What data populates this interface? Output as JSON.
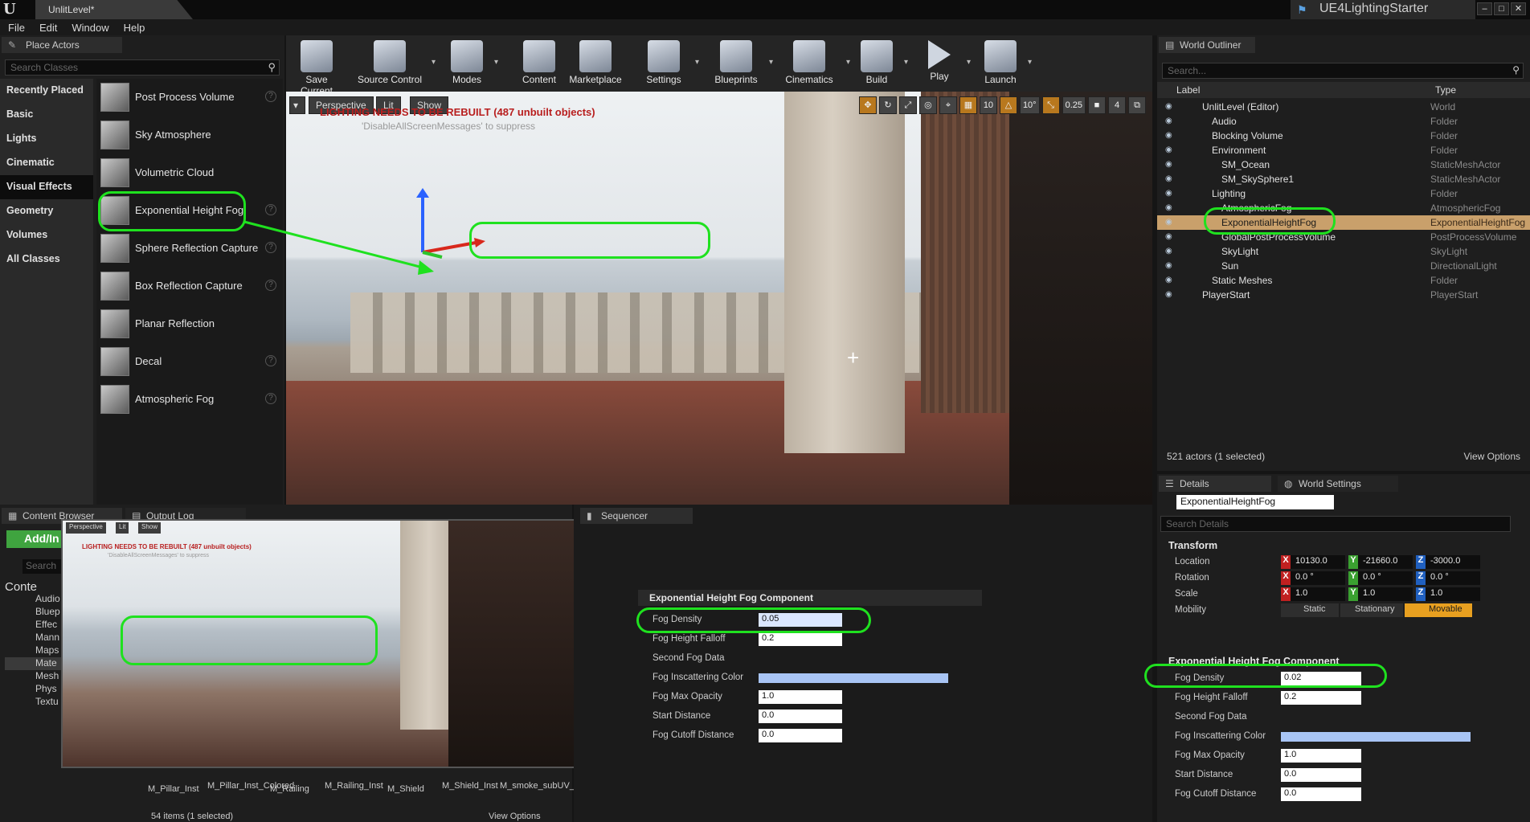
{
  "window": {
    "level_tab": "UnlitLevel*",
    "project": "UE4LightingStarter",
    "controls": [
      "–",
      "□",
      "✕"
    ]
  },
  "menu": [
    "File",
    "Edit",
    "Window",
    "Help"
  ],
  "place_actors": {
    "tab": "Place Actors",
    "search_placeholder": "Search Classes",
    "categories": [
      "Recently Placed",
      "Basic",
      "Lights",
      "Cinematic",
      "Visual Effects",
      "Geometry",
      "Volumes",
      "All Classes"
    ],
    "selected_category": "Visual Effects",
    "actors": [
      "Post Process Volume",
      "Sky Atmosphere",
      "Volumetric Cloud",
      "Exponential Height Fog",
      "Sphere Reflection Capture",
      "Box Reflection Capture",
      "Planar Reflection",
      "Decal",
      "Atmospheric Fog"
    ]
  },
  "toolbar": [
    "Save Current",
    "Source Control",
    "Modes",
    "Content",
    "Marketplace",
    "Settings",
    "Blueprints",
    "Cinematics",
    "Build",
    "Play",
    "Launch"
  ],
  "viewport": {
    "perspective": "Perspective",
    "lit": "Lit",
    "show": "Show",
    "warning": "LIGHTING NEEDS TO BE REBUILT (487 unbuilt objects)",
    "suppress": "'DisableAllScreenMessages' to suppress",
    "grid_snap": "10",
    "rot_snap": "10°",
    "scale_snap": "0.25",
    "cam_speed": "4"
  },
  "outliner": {
    "tab": "World Outliner",
    "search_placeholder": "Search...",
    "col_label": "Label",
    "col_type": "Type",
    "rows": [
      {
        "label": "UnlitLevel (Editor)",
        "type": "World"
      },
      {
        "label": "Audio",
        "type": "Folder"
      },
      {
        "label": "Blocking Volume",
        "type": "Folder"
      },
      {
        "label": "Environment",
        "type": "Folder"
      },
      {
        "label": "SM_Ocean",
        "type": "StaticMeshActor"
      },
      {
        "label": "SM_SkySphere1",
        "type": "StaticMeshActor"
      },
      {
        "label": "Lighting",
        "type": "Folder"
      },
      {
        "label": "AtmosphericFog",
        "type": "AtmosphericFog"
      },
      {
        "label": "ExponentialHeightFog",
        "type": "ExponentialHeightFog"
      },
      {
        "label": "GlobalPostProcessVolume",
        "type": "PostProcessVolume"
      },
      {
        "label": "SkyLight",
        "type": "SkyLight"
      },
      {
        "label": "Sun",
        "type": "DirectionalLight"
      },
      {
        "label": "Static Meshes",
        "type": "Folder"
      },
      {
        "label": "PlayerStart",
        "type": "PlayerStart"
      }
    ],
    "count": "521 actors (1 selected)",
    "view_options": "View Options"
  },
  "details": {
    "tab": "Details",
    "tab2": "World Settings",
    "name": "ExponentialHeightFog",
    "search_placeholder": "Search Details",
    "transform": "Transform",
    "location_label": "Location",
    "rotation_label": "Rotation",
    "scale_label": "Scale",
    "mobility_label": "Mobility",
    "location": [
      "10130.0",
      "-21660.0",
      "-3000.0"
    ],
    "rotation": [
      "0.0 °",
      "0.0 °",
      "0.0 °"
    ],
    "scale": [
      "1.0",
      "1.0",
      "1.0"
    ],
    "mobility": [
      "Static",
      "Stationary",
      "Movable"
    ],
    "component": "Exponential Height Fog Component",
    "props": [
      {
        "label": "Fog Density",
        "value": "0.02"
      },
      {
        "label": "Fog Height Falloff",
        "value": "0.2"
      },
      {
        "label": "Second Fog Data",
        "value": ""
      },
      {
        "label": "Fog Inscattering Color",
        "value": ""
      },
      {
        "label": "Fog Max Opacity",
        "value": "1.0"
      },
      {
        "label": "Start Distance",
        "value": "0.0"
      },
      {
        "label": "Fog Cutoff Distance",
        "value": "0.0"
      }
    ]
  },
  "bottom": {
    "content_tab": "Content Browser",
    "output_tab": "Output Log",
    "add_new": "Add/In",
    "search": "Search",
    "tree": [
      "Conte",
      "Audio",
      "Bluep",
      "Effec",
      "Mann",
      "Maps",
      "Mate",
      "Mesh",
      "Phys",
      "Textu"
    ],
    "assets": [
      "M_Pillar_Inst",
      "M_Pillar_Inst_Colored",
      "M_Railing",
      "M_Railing_Inst",
      "M_Shield",
      "M_Shield_Inst",
      "M_smoke_subUV_"
    ],
    "items": "54 items (1 selected)",
    "view_options": "View Options",
    "sequencer_tab": "Sequencer",
    "seq_component": "Exponential Height Fog Component",
    "seq_props": [
      {
        "label": "Fog Density",
        "value": "0.05"
      },
      {
        "label": "Fog Height Falloff",
        "value": "0.2"
      },
      {
        "label": "Second Fog Data",
        "value": ""
      },
      {
        "label": "Fog Inscattering Color",
        "value": ""
      },
      {
        "label": "Fog Max Opacity",
        "value": "1.0"
      },
      {
        "label": "Start Distance",
        "value": "0.0"
      },
      {
        "label": "Fog Cutoff Distance",
        "value": "0.0"
      }
    ],
    "mini_warning": "LIGHTING NEEDS TO BE REBUILT (487 unbuilt objects)",
    "mini_suppress": "'DisableAllScreenMessages' to suppress",
    "mini_perspective": "Perspective",
    "mini_lit": "Lit",
    "mini_show": "Show"
  },
  "colors": {
    "highlight": "#1fe11f",
    "selection": "#c9a06b",
    "warning": "#b81e1e"
  }
}
